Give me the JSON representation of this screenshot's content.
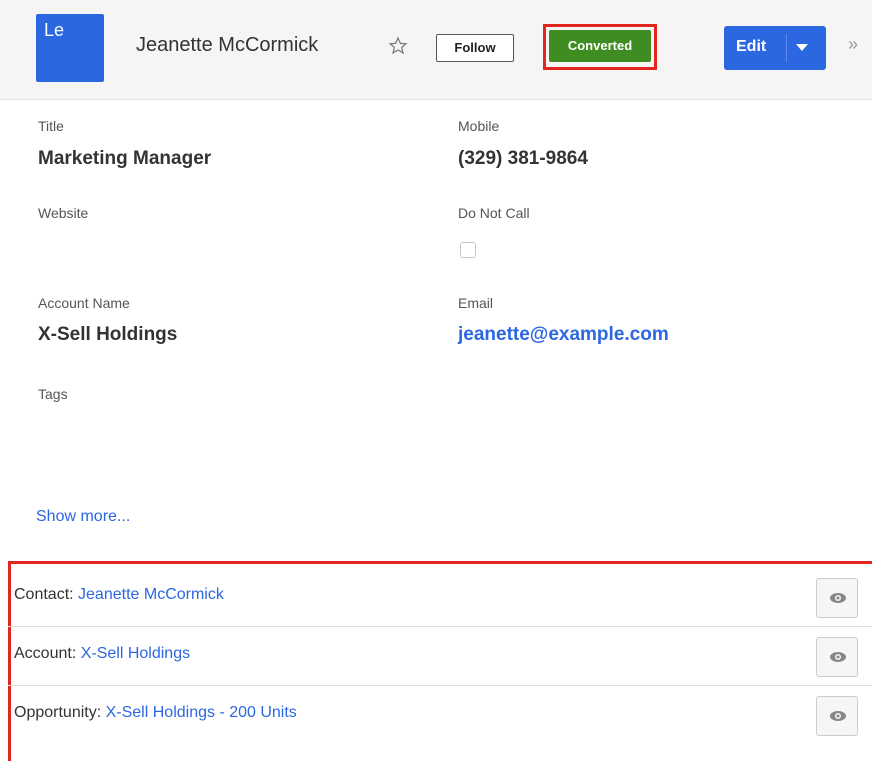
{
  "header": {
    "avatar_text": "Le",
    "record_name": "Jeanette McCormick",
    "follow_label": "Follow",
    "status_label": "Converted",
    "edit_label": "Edit",
    "more_glyph": "»"
  },
  "fields": {
    "title": {
      "label": "Title",
      "value": "Marketing Manager"
    },
    "mobile": {
      "label": "Mobile",
      "value": "(329) 381-9864"
    },
    "website": {
      "label": "Website",
      "value": ""
    },
    "do_not_call": {
      "label": "Do Not Call",
      "checked": false
    },
    "account_name": {
      "label": "Account Name",
      "value": "X-Sell Holdings"
    },
    "email": {
      "label": "Email",
      "value": "jeanette@example.com"
    },
    "tags": {
      "label": "Tags",
      "value": ""
    }
  },
  "show_more": "Show more...",
  "related": [
    {
      "prefix": "Contact: ",
      "link": "Jeanette McCormick"
    },
    {
      "prefix": "Account: ",
      "link": "X-Sell Holdings"
    },
    {
      "prefix": "Opportunity: ",
      "link": "X-Sell Holdings - 200 Units"
    }
  ],
  "colors": {
    "accent": "#2b67e0",
    "converted": "#3f8d22",
    "highlight": "#e0261d"
  }
}
